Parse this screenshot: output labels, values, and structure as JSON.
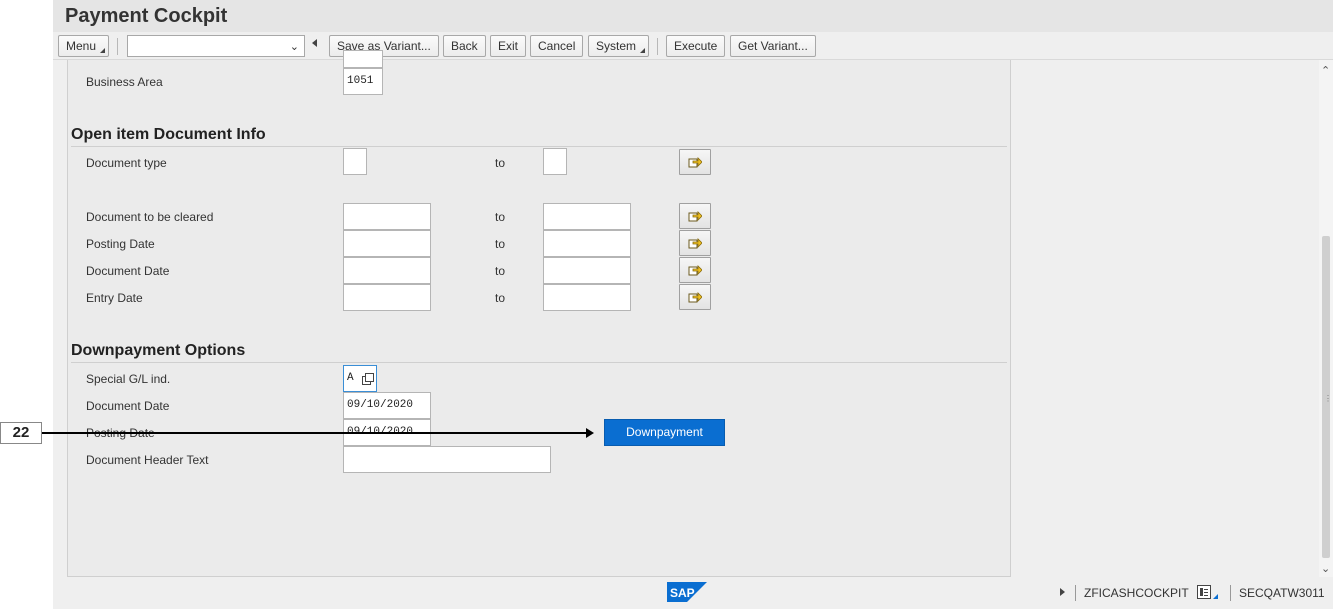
{
  "window": {
    "title": "Payment Cockpit"
  },
  "toolbar": {
    "menu_label": "Menu",
    "variant_value": "",
    "save_variant_label": "Save as Variant...",
    "back_label": "Back",
    "exit_label": "Exit",
    "cancel_label": "Cancel",
    "system_label": "System",
    "execute_label": "Execute",
    "get_variant_label": "Get Variant..."
  },
  "form": {
    "business_area": {
      "label": "Business Area",
      "value": "1051"
    },
    "open_item_section": {
      "title": "Open item Document Info"
    },
    "to_label": "to",
    "rows": [
      {
        "label": "Document type",
        "from": "",
        "to": ""
      },
      {
        "label": "Document to be cleared",
        "from": "",
        "to": ""
      },
      {
        "label": "Posting Date",
        "from": "",
        "to": ""
      },
      {
        "label": "Document Date",
        "from": "",
        "to": ""
      },
      {
        "label": "Entry Date",
        "from": "",
        "to": ""
      }
    ],
    "downpayment_section": {
      "title": "Downpayment Options",
      "special_gl": {
        "label": "Special G/L ind.",
        "value": "A"
      },
      "document_date": {
        "label": "Document Date",
        "value": "09/10/2020"
      },
      "posting_date": {
        "label": "Posting Date",
        "value": "09/10/2020"
      },
      "header_text": {
        "label": "Document Header Text",
        "value": ""
      },
      "button_label": "Downpayment"
    }
  },
  "statusbar": {
    "logo_text": "SAP",
    "transaction": "ZFICASHCOCKPIT",
    "server": "SECQATW3011"
  },
  "annotation": {
    "step": "22"
  },
  "colors": {
    "accent": "#0a6ed1",
    "background": "#efefef",
    "panel": "#ebebeb"
  }
}
